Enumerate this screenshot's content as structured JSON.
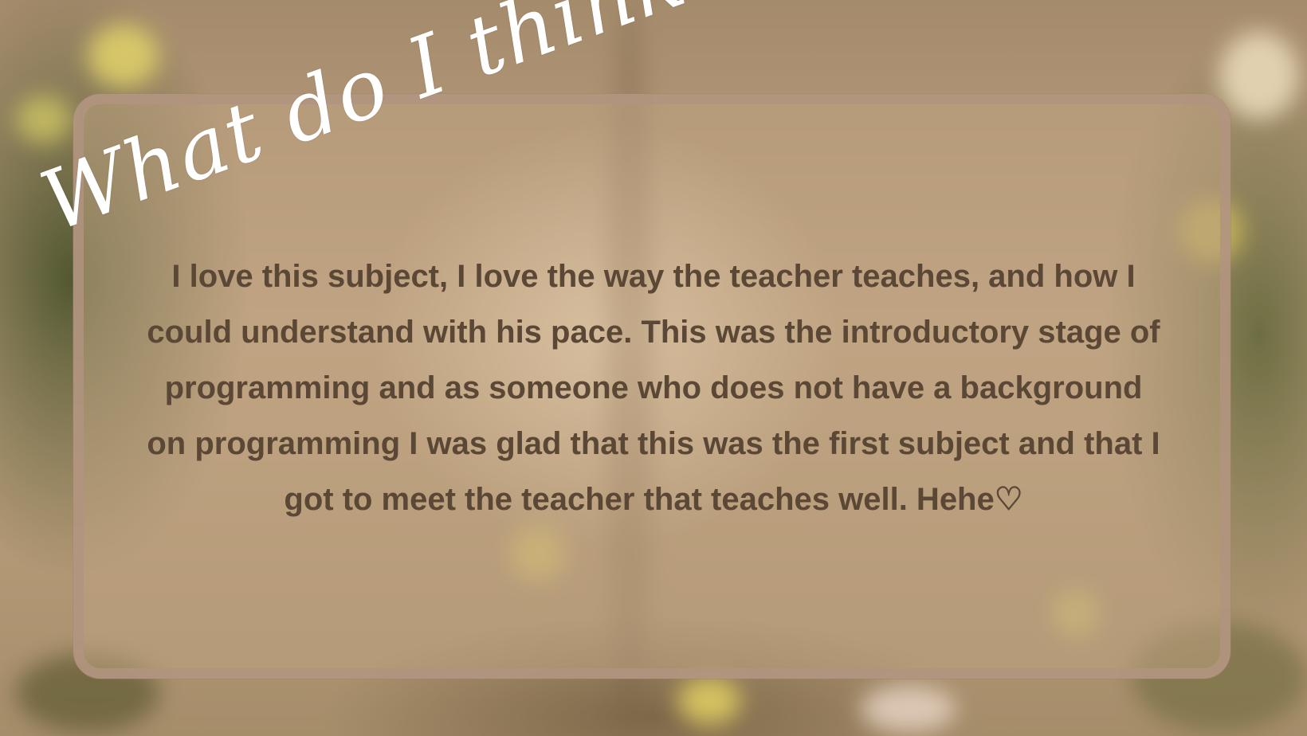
{
  "slide": {
    "title": "What do I think?",
    "body": "I love this subject, I love the way the teacher teaches, and how I could understand with his pace. This was the introductory stage of programming and as someone who does not have a background on programming I was glad that this was the first subject and that I got to meet the teacher that teaches well. Hehe♡"
  },
  "colors": {
    "title": "#ffffff",
    "body_text": "#5b4736",
    "card_border": "#b29480"
  }
}
